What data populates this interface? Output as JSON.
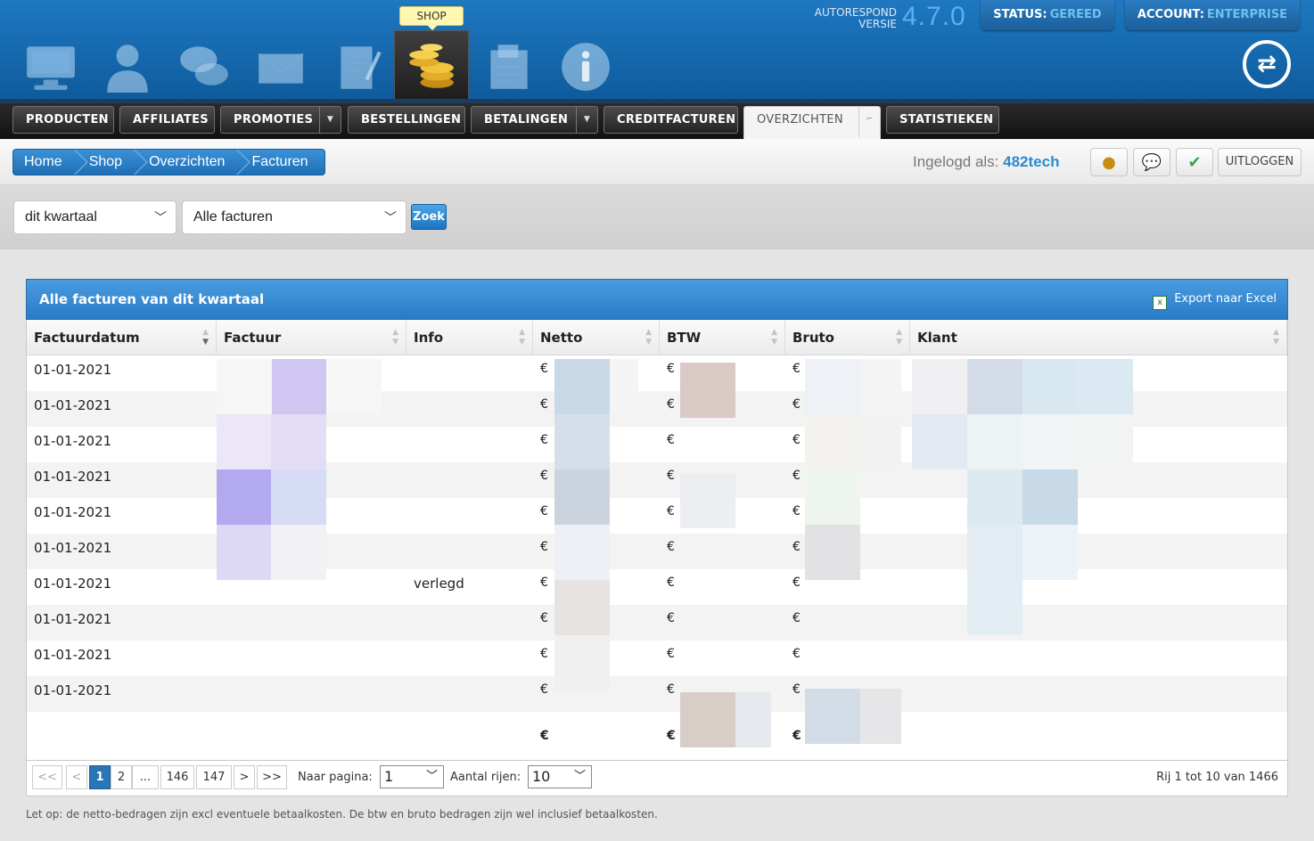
{
  "header": {
    "shop_tooltip": "SHOP",
    "version_label_1": "AUTORESPOND",
    "version_label_2": "VERSIE",
    "version": "4.7.0",
    "status_label": "STATUS:",
    "status_value": "GEREED",
    "account_label": "ACCOUNT:",
    "account_value": "ENTERPRISE",
    "toolbar_icons": [
      "monitor-icon",
      "user-icon",
      "chat-icon",
      "envelope-icon",
      "document-pen-icon",
      "coins-icon",
      "floppy-form-icon",
      "info-icon"
    ]
  },
  "tabs": [
    {
      "label": "PRODUCTEN",
      "dropdown": false
    },
    {
      "label": "AFFILIATES",
      "dropdown": false
    },
    {
      "label": "PROMOTIES",
      "dropdown": true
    },
    {
      "label": "BESTELLINGEN",
      "dropdown": false
    },
    {
      "label": "BETALINGEN",
      "dropdown": true
    },
    {
      "label": "CREDITFACTUREN",
      "dropdown": false
    },
    {
      "label": "OVERZICHTEN",
      "dropdown": true,
      "active": true
    },
    {
      "label": "STATISTIEKEN",
      "dropdown": false
    }
  ],
  "breadcrumb": [
    "Home",
    "Shop",
    "Overzichten",
    "Facturen"
  ],
  "login": {
    "label": "Ingelogd als:",
    "user": "482tech",
    "logout": "UITLOGGEN"
  },
  "filters": {
    "period": "dit kwartaal",
    "type": "Alle facturen",
    "search": "Zoek"
  },
  "panel": {
    "title": "Alle facturen van dit kwartaal",
    "export": "Export naar Excel"
  },
  "table": {
    "columns": [
      "Factuurdatum",
      "Factuur",
      "Info",
      "Netto",
      "BTW",
      "Bruto",
      "Klant"
    ],
    "rows": [
      {
        "date": "01-01-2021",
        "info": ""
      },
      {
        "date": "01-01-2021",
        "info": ""
      },
      {
        "date": "01-01-2021",
        "info": ""
      },
      {
        "date": "01-01-2021",
        "info": ""
      },
      {
        "date": "01-01-2021",
        "info": ""
      },
      {
        "date": "01-01-2021",
        "info": ""
      },
      {
        "date": "01-01-2021",
        "info": "verlegd"
      },
      {
        "date": "01-01-2021",
        "info": ""
      },
      {
        "date": "01-01-2021",
        "info": ""
      },
      {
        "date": "01-01-2021",
        "info": ""
      }
    ],
    "currency": "€"
  },
  "pager": {
    "first": "<<",
    "prev": "<",
    "pages": [
      "1",
      "2",
      "...",
      "146",
      "147"
    ],
    "next": ">",
    "last": ">>",
    "goto_label": "Naar pagina:",
    "goto_value": "1",
    "rows_label": "Aantal rijen:",
    "rows_value": "10",
    "info": "Rij 1 tot 10 van 1466"
  },
  "note": "Let op: de netto-bedragen zijn excl eventuele betaalkosten. De btw en bruto bedragen zijn wel inclusief betaalkosten.",
  "colors": {
    "accent": "#2a7bc6",
    "header_bg": "#1566a8",
    "tabbar_bg": "#1a1a1a"
  }
}
